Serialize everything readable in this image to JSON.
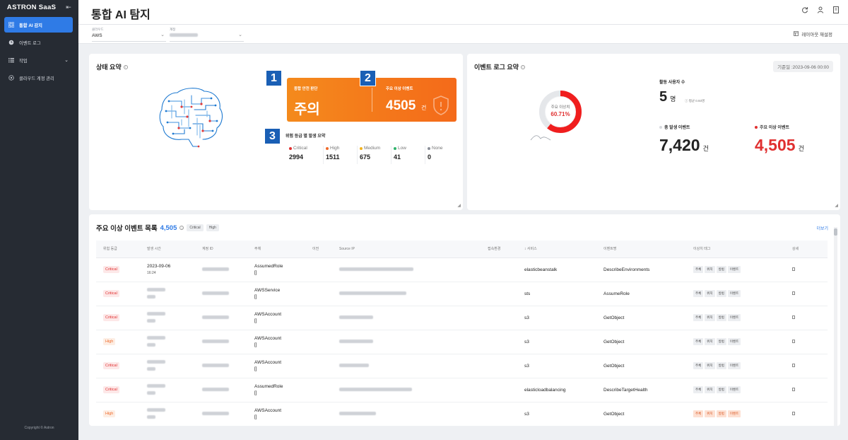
{
  "brand": {
    "name": "ASTRON SaaS",
    "collapse_glyph": "⇤"
  },
  "sidebar": {
    "items": [
      {
        "label": "통합 AI 감지",
        "icon": "grid-icon"
      },
      {
        "label": "이벤트 로그",
        "icon": "clock-icon"
      },
      {
        "label": "작업",
        "icon": "list-icon"
      },
      {
        "label": "클라우드 계정 관리",
        "icon": "gear-icon"
      }
    ],
    "copyright": "Copyright © Astron"
  },
  "header": {
    "title": "통합 AI 탐지"
  },
  "filters": {
    "cloud_label": "클라우드",
    "cloud_value": "AWS",
    "account_label": "계정",
    "layout_reset": "레이아웃 재설정"
  },
  "status": {
    "title": "상태 요약",
    "badges": [
      "1",
      "2",
      "3"
    ],
    "overall_label": "종합 안전 판단",
    "overall_value": "주의",
    "anomaly_label": "주요 이상 이벤트",
    "anomaly_value": "4505",
    "anomaly_unit": "건",
    "risk_title": "위험 등급 별 발생 요약",
    "risks": [
      {
        "label": "Critical",
        "value": "2994",
        "color": "#e03030"
      },
      {
        "label": "High",
        "value": "1511",
        "color": "#f06a2a"
      },
      {
        "label": "Medium",
        "value": "675",
        "color": "#f2b21b"
      },
      {
        "label": "Low",
        "value": "41",
        "color": "#2fb36b"
      },
      {
        "label": "None",
        "value": "0",
        "color": "#8a8f98"
      }
    ]
  },
  "event_summary": {
    "title": "이벤트 로그 요약",
    "date": "기준일 :2023-09-06 00:00",
    "donut_label": "주요 이상치",
    "donut_percent": "60.71%",
    "donut_fraction": 0.6071,
    "active_users_label": "활동 사용자 수",
    "active_users_value": "5",
    "active_users_unit": "명",
    "avg_note": "평균 0.93명",
    "total_label": "총 발생 이벤트",
    "total_value": "7,420",
    "total_unit": "건",
    "anomaly_label": "주요 이상 이벤트",
    "anomaly_value": "4,505",
    "anomaly_unit": "건"
  },
  "anomaly_list": {
    "title": "주요 이상 이벤트 목록",
    "count": "4,505",
    "chips": [
      "Critical",
      "High"
    ],
    "more": "더보기",
    "columns": [
      "위험 등급",
      "발생 시간",
      "계정 ID",
      "주체",
      "이전",
      "Source IP",
      "접속환경",
      "서비스",
      "이벤트명",
      "이상치 태그",
      "상세"
    ],
    "rows": [
      {
        "level": "Critical",
        "time": "2023-09-06",
        "time2": "16:24",
        "actor": "AssumedRole",
        "actor2": "[]",
        "service": "elasticbeanstalk",
        "event": "DescribeEnvironments",
        "tags": [
          "주체",
          "위치",
          "방법",
          "이벤트"
        ],
        "warn": false
      },
      {
        "level": "Critical",
        "time": "",
        "time2": "",
        "actor": "AWSService",
        "actor2": "[]",
        "service": "sts",
        "event": "AssumeRole",
        "tags": [
          "주체",
          "위치",
          "방법",
          "이벤트"
        ],
        "warn": false
      },
      {
        "level": "Critical",
        "time": "",
        "time2": "",
        "actor": "AWSAccount",
        "actor2": "[]",
        "service": "s3",
        "event": "GetObject",
        "tags": [
          "주체",
          "위치",
          "방법",
          "이벤트"
        ],
        "warn": false
      },
      {
        "level": "High",
        "time": "",
        "time2": "",
        "actor": "AWSAccount",
        "actor2": "[]",
        "service": "s3",
        "event": "GetObject",
        "tags": [
          "주체",
          "위치",
          "방법",
          "이벤트"
        ],
        "warn": false
      },
      {
        "level": "Critical",
        "time": "",
        "time2": "",
        "actor": "AWSAccount",
        "actor2": "[]",
        "service": "s3",
        "event": "GetObject",
        "tags": [
          "주체",
          "위치",
          "방법",
          "이벤트"
        ],
        "warn": false
      },
      {
        "level": "Critical",
        "time": "",
        "time2": "",
        "actor": "AssumedRole",
        "actor2": "[]",
        "service": "elasticloadbalancing",
        "event": "DescribeTargetHealth",
        "tags": [
          "주체",
          "위치",
          "방법",
          "이벤트"
        ],
        "warn": false
      },
      {
        "level": "High",
        "time": "",
        "time2": "",
        "actor": "AWSAccount",
        "actor2": "[]",
        "service": "s3",
        "event": "GetObject",
        "tags": [
          "주체",
          "위치",
          "방법",
          "이벤트"
        ],
        "warn": true
      }
    ]
  },
  "colors": {
    "sidebar": "#262b33",
    "accent": "#2f7be6",
    "orange": "#f47a1c",
    "critical": "#e03030"
  }
}
